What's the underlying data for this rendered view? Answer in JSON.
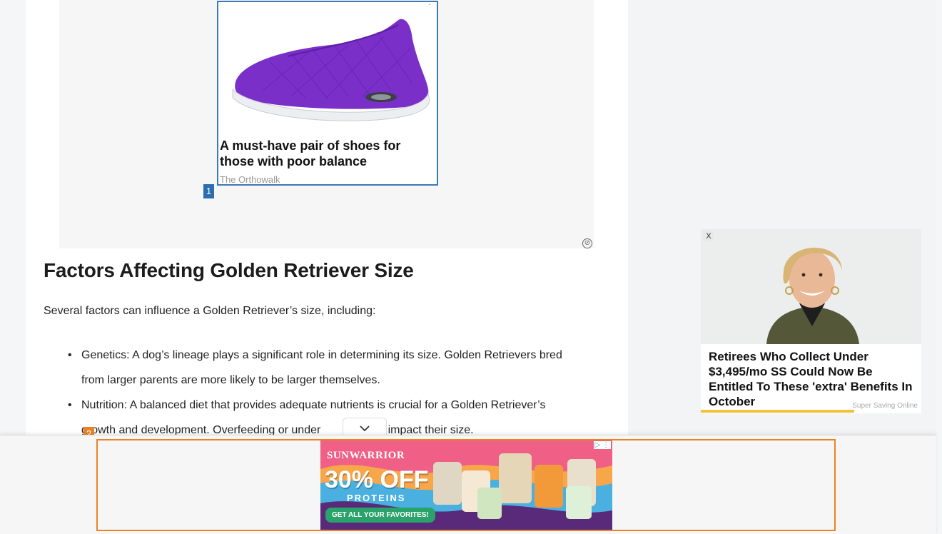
{
  "top_ad": {
    "headline": "A must-have pair of shoes for those with poor balance",
    "source": "The Orthowalk",
    "marker": "1",
    "adchoice_icon": "adchoices-icon",
    "info_icon": "ad-info-icon"
  },
  "article": {
    "heading": "Factors Affecting Golden Retriever Size",
    "intro": "Several factors can influence a Golden Retriever’s size, including:",
    "factors": [
      {
        "line1": "Genetics: A dog’s lineage plays a significant role in determining its size. Golden Retrievers bred",
        "line2": "from larger parents are more likely to be larger themselves."
      },
      {
        "line1": "Nutrition: A balanced diet that provides adequate nutrients is crucial for a Golden Retriever’s",
        "line2": "growth and development. Overfeeding or under",
        "line2b": "can impact their size."
      }
    ],
    "marker": "2"
  },
  "sidebar_ad": {
    "close_label": "X",
    "headline": "Retirees Who Collect Under $3,495/mo SS Could Now Be Entitled To These 'extra' Benefits In October",
    "source": "Super Saving Online"
  },
  "bottom_ad": {
    "brand": "SUNWARRIOR",
    "discount": "30% OFF",
    "subtitle": "PROTEINS",
    "cta": "GET ALL YOUR FAVORITES!",
    "adchoice": "▷ ⋮"
  },
  "colors": {
    "ad_outline_blue": "#3d79b8",
    "ad_outline_orange": "#e88426",
    "accent_yellow": "#f3c23c"
  }
}
